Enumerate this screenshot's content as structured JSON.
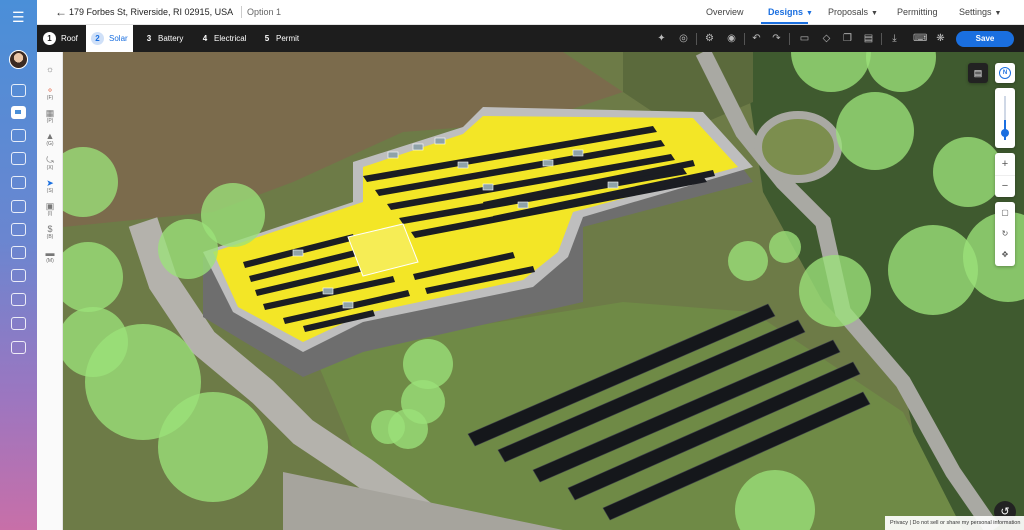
{
  "header": {
    "address": "179 Forbes St, Riverside, RI 02915, USA",
    "option": "Option 1",
    "nav": [
      {
        "label": "Overview"
      },
      {
        "label": "Designs"
      },
      {
        "label": "Proposals"
      },
      {
        "label": "Permitting"
      },
      {
        "label": "Settings"
      }
    ]
  },
  "toolbar": {
    "steps": [
      {
        "num": "1",
        "label": "Roof"
      },
      {
        "num": "2",
        "label": "Solar"
      },
      {
        "num": "3",
        "label": "Battery"
      },
      {
        "num": "4",
        "label": "Electrical"
      },
      {
        "num": "5",
        "label": "Permit"
      }
    ],
    "save_label": "Save"
  },
  "tools": [
    {
      "icon": "sun-icon",
      "count": ""
    },
    {
      "icon": "circle-icon",
      "count": "(F)"
    },
    {
      "icon": "fence-icon",
      "count": "(P)"
    },
    {
      "icon": "chimney-icon",
      "count": "(G)"
    },
    {
      "icon": "wire-icon",
      "count": "(X)"
    },
    {
      "icon": "pointer-icon",
      "count": "(S)"
    },
    {
      "icon": "image-icon",
      "count": "(I)"
    },
    {
      "icon": "dollar-icon",
      "count": "(B)"
    },
    {
      "icon": "ruler-icon",
      "count": "(M)"
    }
  ],
  "map_controls": {
    "compass_label": "N"
  },
  "footer": {
    "privacy": "Privacy  |  Do not sell or share my personal information"
  },
  "colors": {
    "accent": "#1a6fe0",
    "roof": "#f3e626",
    "panel": "#1b1d22",
    "tree": "#9be27a"
  }
}
